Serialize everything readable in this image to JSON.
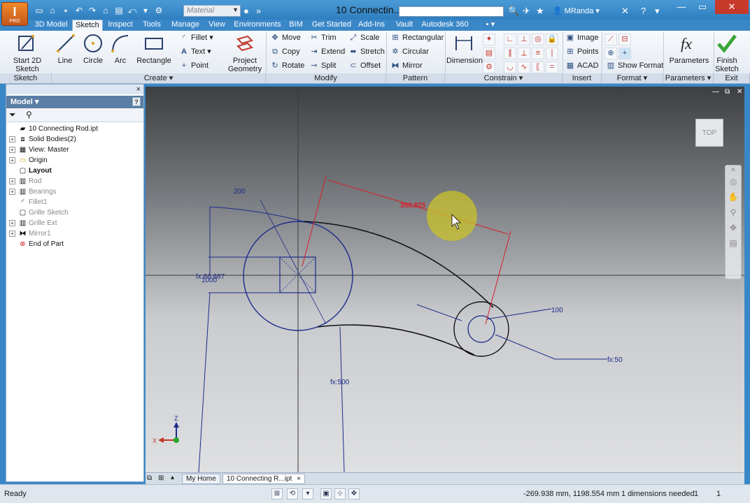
{
  "app": {
    "logo_letter": "I",
    "logo_sub": "PRO",
    "title": "10 Connectin...",
    "material_placeholder": "Material",
    "user_name": "MRanda"
  },
  "tabs": [
    "3D Model",
    "Sketch",
    "Inspect",
    "Tools",
    "Manage",
    "View",
    "Environments",
    "BIM",
    "Get Started",
    "Add-Ins",
    "Vault",
    "Autodesk 360"
  ],
  "active_tab": "Sketch",
  "ribbon": {
    "panels": {
      "sketch": "Sketch",
      "create": "Create ▾",
      "modify": "Modify",
      "pattern": "Pattern",
      "constrain": "Constrain ▾",
      "insert": "Insert",
      "format": "Format ▾",
      "parameters": "Parameters ▾",
      "exit": "Exit"
    },
    "start_2d_sketch": "Start 2D Sketch",
    "line": "Line",
    "circle": "Circle",
    "arc": "Arc",
    "rectangle": "Rectangle",
    "fillet": "Fillet ▾",
    "text": "Text ▾",
    "point": "Point",
    "project_geometry": "Project Geometry",
    "move": "Move",
    "copy": "Copy",
    "rotate": "Rotate",
    "trim": "Trim",
    "extend": "Extend",
    "split": "Split",
    "scale": "Scale",
    "stretch": "Stretch",
    "offset": "Offset",
    "rect_pattern": "Rectangular",
    "circular": "Circular",
    "mirror": "Mirror",
    "dimension": "Dimension",
    "image": "Image",
    "points": "Points",
    "acad": "ACAD",
    "show_format": "Show Format",
    "parameters": "Parameters",
    "finish_sketch": "Finish Sketch"
  },
  "browser": {
    "title": "Model ▾",
    "help": "?",
    "close": "×",
    "nodes": [
      {
        "label": "10 Connecting Rod.ipt",
        "icon": "part-icon",
        "expand": "",
        "style": ""
      },
      {
        "label": "Solid Bodies(2)",
        "icon": "solid-bodies-icon",
        "expand": "+",
        "style": ""
      },
      {
        "label": "View: Master",
        "icon": "view-icon",
        "expand": "+",
        "style": ""
      },
      {
        "label": "Origin",
        "icon": "folder-icon",
        "expand": "+",
        "style": ""
      },
      {
        "label": "Layout",
        "icon": "sketch-icon",
        "expand": "",
        "style": "bold"
      },
      {
        "label": "Rod",
        "icon": "extrusion-icon",
        "expand": "+",
        "style": "dim"
      },
      {
        "label": "Bearings",
        "icon": "extrusion-icon",
        "expand": "+",
        "style": "dim"
      },
      {
        "label": "Fillet1",
        "icon": "fillet-icon",
        "expand": "",
        "style": "dim"
      },
      {
        "label": "Grille Sketch",
        "icon": "sketch-icon",
        "expand": "",
        "style": "dim"
      },
      {
        "label": "Grille Ext",
        "icon": "extrusion-icon",
        "expand": "+",
        "style": "dim"
      },
      {
        "label": "Mirror1",
        "icon": "mirror-icon",
        "expand": "+",
        "style": "dim"
      },
      {
        "label": "End of Part",
        "icon": "end-of-part-icon",
        "expand": "",
        "style": ""
      }
    ]
  },
  "viewport": {
    "viewcube_label": "TOP",
    "dimensions": {
      "d200": "200",
      "d350": "350.825",
      "d100": "100",
      "fx50": "fx:50",
      "fx500": "fx:500",
      "fx666": "fx:66.667",
      "d1000": "1000"
    },
    "axis": {
      "x": "X",
      "z": "Z"
    }
  },
  "doc_tabs": {
    "home": "My Home",
    "doc": "10 Connecting R...ipt",
    "close": "×"
  },
  "status": {
    "ready": "Ready",
    "coords": "-269.938 mm, 1198.554 mm",
    "dims_needed": "1 dimensions needed",
    "count1": "1",
    "count2": "1"
  },
  "colors": {
    "accent": "#3a87c8",
    "sketch_blue": "#1c2b8a",
    "dimension_red": "#d6202a"
  }
}
